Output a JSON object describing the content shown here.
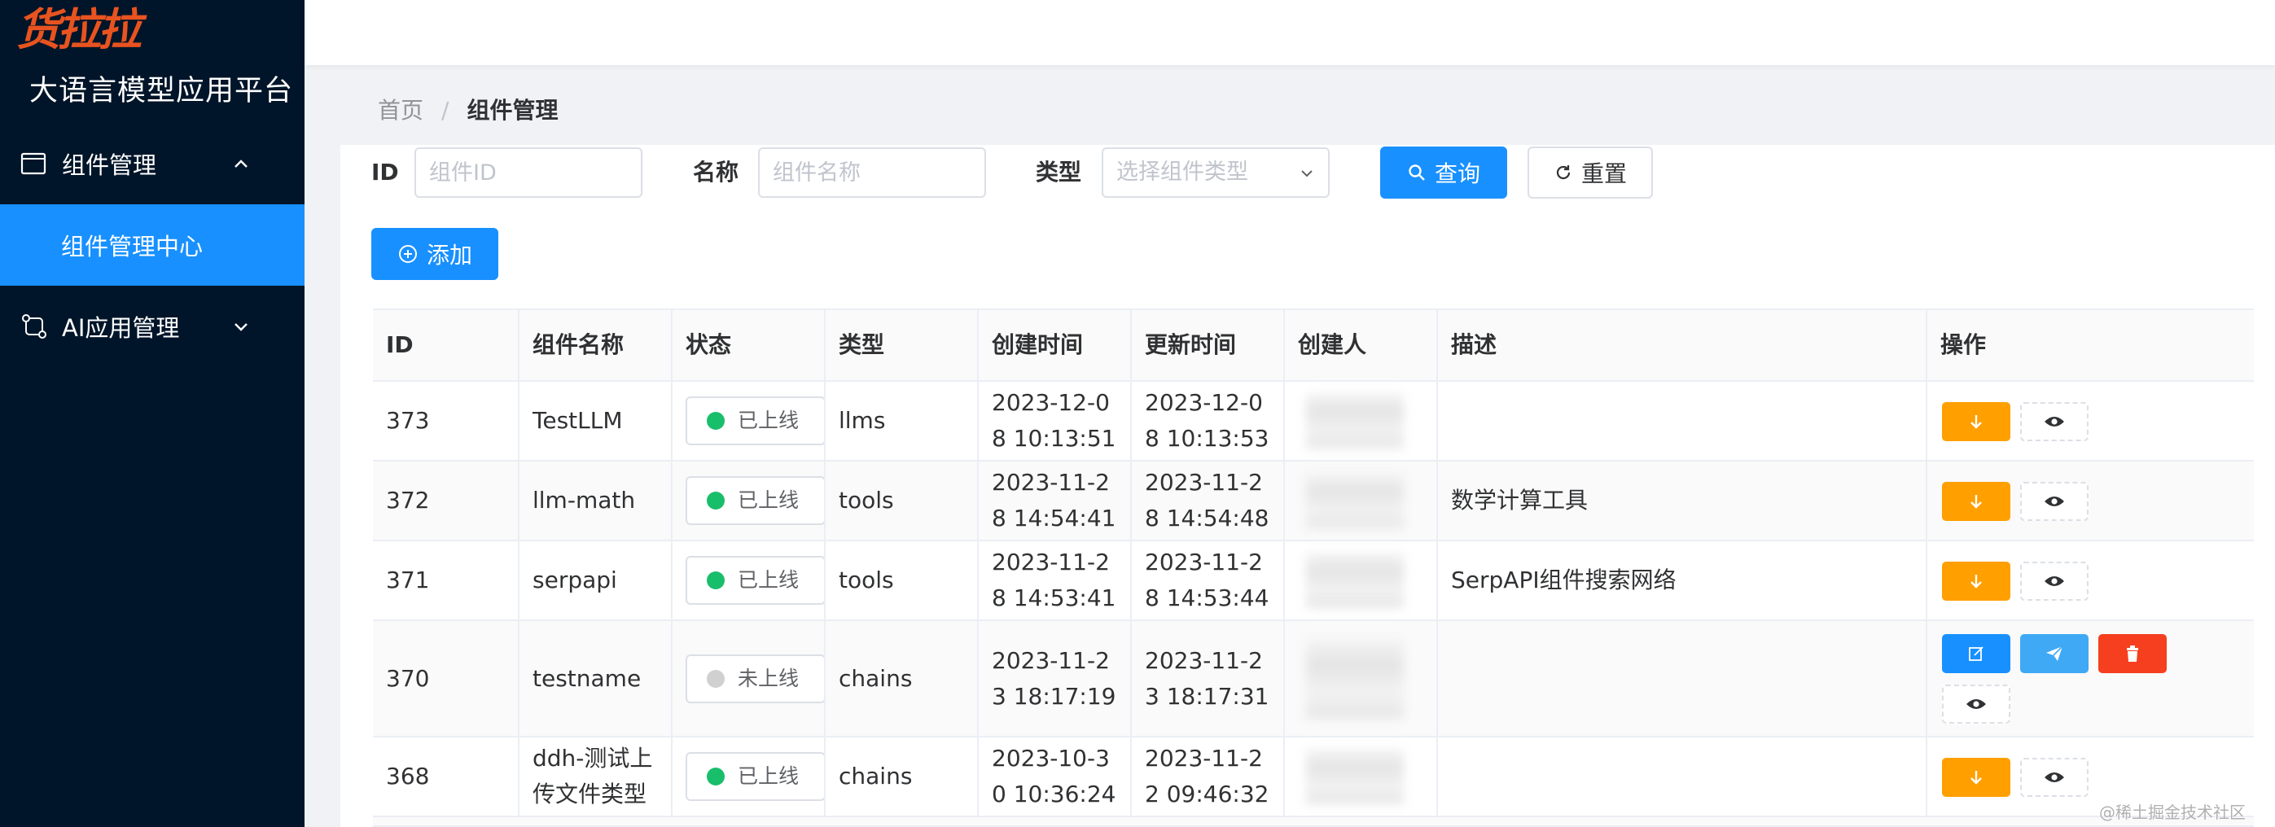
{
  "sidebar": {
    "logo": "货拉拉",
    "platform_title": "大语言模型应用平台",
    "menu": [
      {
        "label": "组件管理",
        "icon": "window-icon",
        "expanded": true
      },
      {
        "label": "组件管理中心",
        "active": true
      },
      {
        "label": "AI应用管理",
        "icon": "flow-icon",
        "expanded": false
      }
    ]
  },
  "breadcrumb": {
    "home": "首页",
    "separator": "/",
    "current": "组件管理"
  },
  "filters": {
    "id_label": "ID",
    "id_placeholder": "组件ID",
    "name_label": "名称",
    "name_placeholder": "组件名称",
    "type_label": "类型",
    "type_placeholder": "选择组件类型",
    "search_label": "查询",
    "reset_label": "重置"
  },
  "add_label": "添加",
  "table": {
    "columns": [
      "ID",
      "组件名称",
      "状态",
      "类型",
      "创建时间",
      "更新时间",
      "创建人",
      "描述",
      "操作"
    ],
    "rows": [
      {
        "id": "373",
        "name": "TestLLM",
        "status": "已上线",
        "online": true,
        "type": "llms",
        "created_1": "2023-12-0",
        "created_2": "8 10:13:51",
        "updated_1": "2023-12-0",
        "updated_2": "8 10:13:53",
        "creator": "",
        "desc": "",
        "ops": [
          "download",
          "view"
        ]
      },
      {
        "id": "372",
        "name": "llm-math",
        "status": "已上线",
        "online": true,
        "type": "tools",
        "created_1": "2023-11-2",
        "created_2": "8 14:54:41",
        "updated_1": "2023-11-2",
        "updated_2": "8 14:54:48",
        "creator": "",
        "desc": "数学计算工具",
        "ops": [
          "download",
          "view"
        ]
      },
      {
        "id": "371",
        "name": "serpapi",
        "status": "已上线",
        "online": true,
        "type": "tools",
        "created_1": "2023-11-2",
        "created_2": "8 14:53:41",
        "updated_1": "2023-11-2",
        "updated_2": "8 14:53:44",
        "creator": "",
        "desc": "SerpAPI组件搜索网络",
        "ops": [
          "download",
          "view"
        ]
      },
      {
        "id": "370",
        "name": "testname",
        "status": "未上线",
        "online": false,
        "type": "chains",
        "created_1": "2023-11-2",
        "created_2": "3 18:17:19",
        "updated_1": "2023-11-2",
        "updated_2": "3 18:17:31",
        "creator": "",
        "desc": "",
        "ops": [
          "edit",
          "send",
          "delete",
          "view"
        ]
      },
      {
        "id": "368",
        "name_1": "ddh-测试上",
        "name_2": "传文件类型",
        "status": "已上线",
        "online": true,
        "type": "chains",
        "created_1": "2023-10-3",
        "created_2": "0 10:36:24",
        "updated_1": "2023-11-2",
        "updated_2": "2 09:46:32",
        "creator": "",
        "desc": "",
        "ops": [
          "download",
          "view"
        ]
      }
    ]
  },
  "colors": {
    "sidebar_bg": "#001529",
    "primary": "#1890ff",
    "online_dot": "#19be6b",
    "offline_dot": "#d0d0d0",
    "download": "#ff9f00",
    "delete": "#f53f1f"
  },
  "watermark": "@稀土掘金技术社区"
}
